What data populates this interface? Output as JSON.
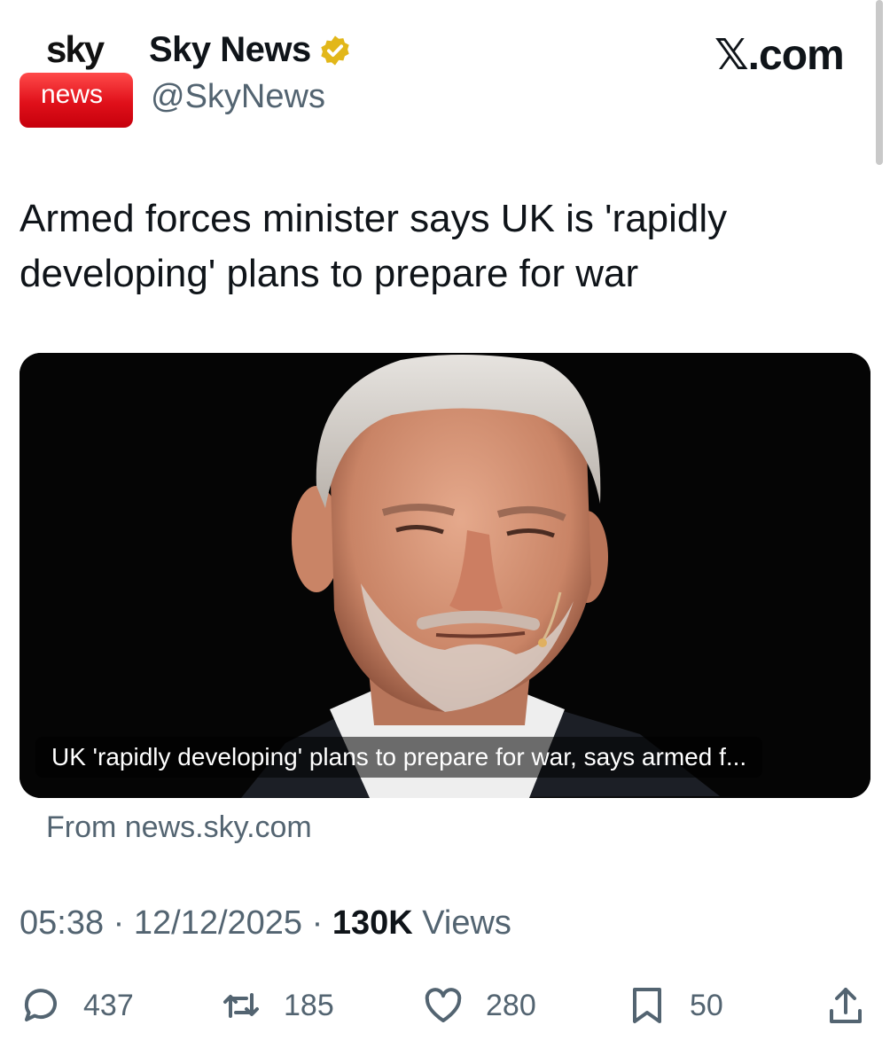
{
  "account": {
    "logo_top": "sky",
    "logo_bottom": "news",
    "display_name": "Sky News",
    "handle": "@SkyNews",
    "verified_icon": "verified-badge-gold"
  },
  "site": {
    "label": "𝕏.com"
  },
  "tweet": {
    "text": "Armed forces minister says UK is 'rapidly developing' plans to prepare for war"
  },
  "card": {
    "caption": "UK 'rapidly developing' plans to prepare for war, says armed f...",
    "source": "From news.sky.com"
  },
  "meta": {
    "time": "05:38",
    "date": "12/12/2025",
    "views_count": "130K",
    "views_label": "Views",
    "separator": "·"
  },
  "actions": {
    "replies": "437",
    "reposts": "185",
    "likes": "280",
    "bookmarks": "50"
  },
  "colors": {
    "text": "#0f1419",
    "secondary": "#536471",
    "verified_gold": "#e2b719",
    "sky_red": "#e0101a"
  }
}
